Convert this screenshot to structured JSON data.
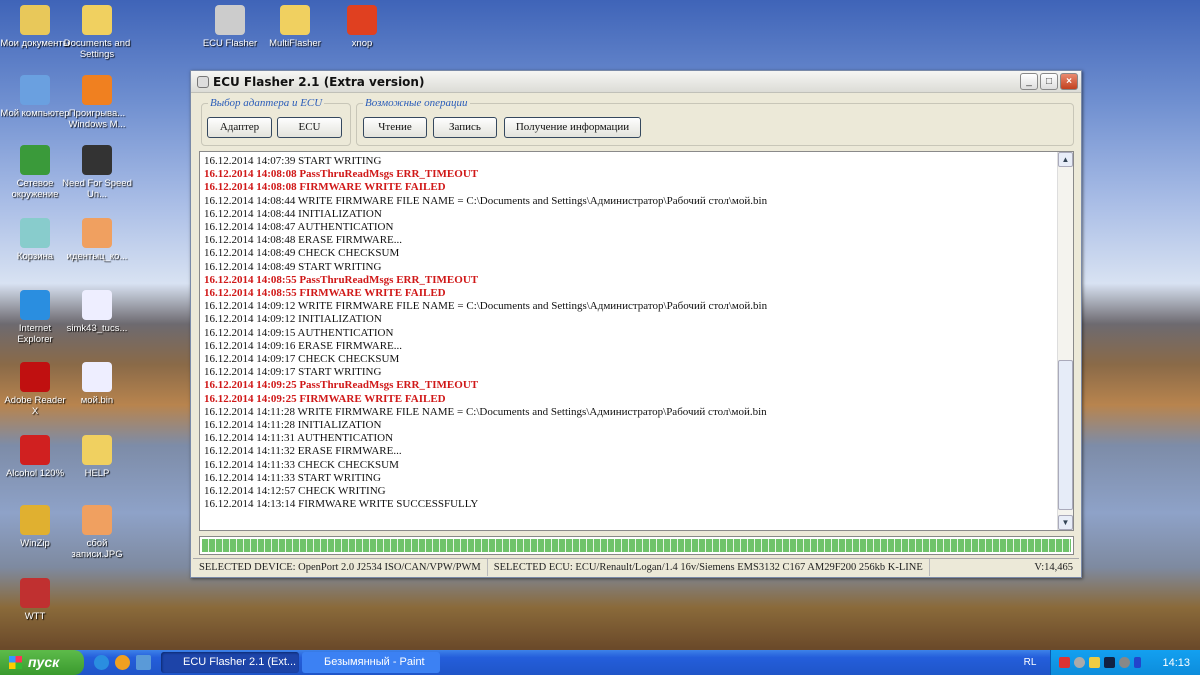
{
  "desktop": {
    "icons": [
      "Мои документы",
      "Documents and Settings",
      "ECU Flasher",
      "MultiFlasher",
      "xnop",
      "Мой компьютер",
      "Проигрыва... Windows M...",
      "Сетевое окружение",
      "Need For Speed Un...",
      "Корзина",
      "идентыц_ко...",
      "Internet Explorer",
      "simk43_tucs...",
      "Adobe Reader X",
      "мой.bin",
      "Alcohol 120%",
      "HELP",
      "WinZip",
      "сбой записи.JPG",
      "WTT"
    ]
  },
  "window": {
    "title": "ECU Flasher 2.1 (Extra version)",
    "group1": {
      "legend": "Выбор адаптера и ECU",
      "buttons": [
        "Адаптер",
        "ECU"
      ]
    },
    "group2": {
      "legend": "Возможные операции",
      "buttons": [
        "Чтение",
        "Запись",
        "Получение информации"
      ]
    },
    "log": [
      {
        "text": "16.12.2014 14:07:39 START WRITING",
        "error": false
      },
      {
        "text": "16.12.2014 14:08:08 PassThruReadMsgs ERR_TIMEOUT",
        "error": true
      },
      {
        "text": "16.12.2014 14:08:08 FIRMWARE WRITE FAILED",
        "error": true
      },
      {
        "text": "16.12.2014 14:08:44 WRITE FIRMWARE FILE NAME = C:\\Documents and Settings\\Администратор\\Рабочий стол\\мой.bin",
        "error": false
      },
      {
        "text": "16.12.2014 14:08:44 INITIALIZATION",
        "error": false
      },
      {
        "text": "16.12.2014 14:08:47 AUTHENTICATION",
        "error": false
      },
      {
        "text": "16.12.2014 14:08:48 ERASE FIRMWARE...",
        "error": false
      },
      {
        "text": "16.12.2014 14:08:49 CHECK CHECKSUM",
        "error": false
      },
      {
        "text": "16.12.2014 14:08:49 START WRITING",
        "error": false
      },
      {
        "text": "16.12.2014 14:08:55 PassThruReadMsgs ERR_TIMEOUT",
        "error": true
      },
      {
        "text": "16.12.2014 14:08:55 FIRMWARE WRITE FAILED",
        "error": true
      },
      {
        "text": "16.12.2014 14:09:12 WRITE FIRMWARE FILE NAME = C:\\Documents and Settings\\Администратор\\Рабочий стол\\мой.bin",
        "error": false
      },
      {
        "text": "16.12.2014 14:09:12 INITIALIZATION",
        "error": false
      },
      {
        "text": "16.12.2014 14:09:15 AUTHENTICATION",
        "error": false
      },
      {
        "text": "16.12.2014 14:09:16 ERASE FIRMWARE...",
        "error": false
      },
      {
        "text": "16.12.2014 14:09:17 CHECK CHECKSUM",
        "error": false
      },
      {
        "text": "16.12.2014 14:09:17 START WRITING",
        "error": false
      },
      {
        "text": "16.12.2014 14:09:25 PassThruReadMsgs ERR_TIMEOUT",
        "error": true
      },
      {
        "text": "16.12.2014 14:09:25 FIRMWARE WRITE FAILED",
        "error": true
      },
      {
        "text": "16.12.2014 14:11:28 WRITE FIRMWARE FILE NAME = C:\\Documents and Settings\\Администратор\\Рабочий стол\\мой.bin",
        "error": false
      },
      {
        "text": "16.12.2014 14:11:28 INITIALIZATION",
        "error": false
      },
      {
        "text": "16.12.2014 14:11:31 AUTHENTICATION",
        "error": false
      },
      {
        "text": "16.12.2014 14:11:32 ERASE FIRMWARE...",
        "error": false
      },
      {
        "text": "16.12.2014 14:11:33 CHECK CHECKSUM",
        "error": false
      },
      {
        "text": "16.12.2014 14:11:33 START WRITING",
        "error": false
      },
      {
        "text": "16.12.2014 14:12:57 CHECK WRITING",
        "error": false
      },
      {
        "text": "16.12.2014 14:13:14 FIRMWARE WRITE SUCCESSFULLY",
        "error": false
      }
    ],
    "progress_percent": 100,
    "status": {
      "device": "SELECTED DEVICE: OpenPort 2.0 J2534 ISO/CAN/VPW/PWM",
      "ecu": "SELECTED ECU: ECU/Renault/Logan/1.4 16v/Siemens EMS3132 C167 AM29F200 256kb K-LINE",
      "version": "V:14,465"
    }
  },
  "taskbar": {
    "start": "пуск",
    "tasks": [
      "ECU Flasher 2.1 (Ext...",
      "Безымянный - Paint"
    ],
    "lang": "RL",
    "clock": "14:13"
  },
  "colors": {
    "error": "#d01818",
    "legend": "#2a5cb8"
  }
}
